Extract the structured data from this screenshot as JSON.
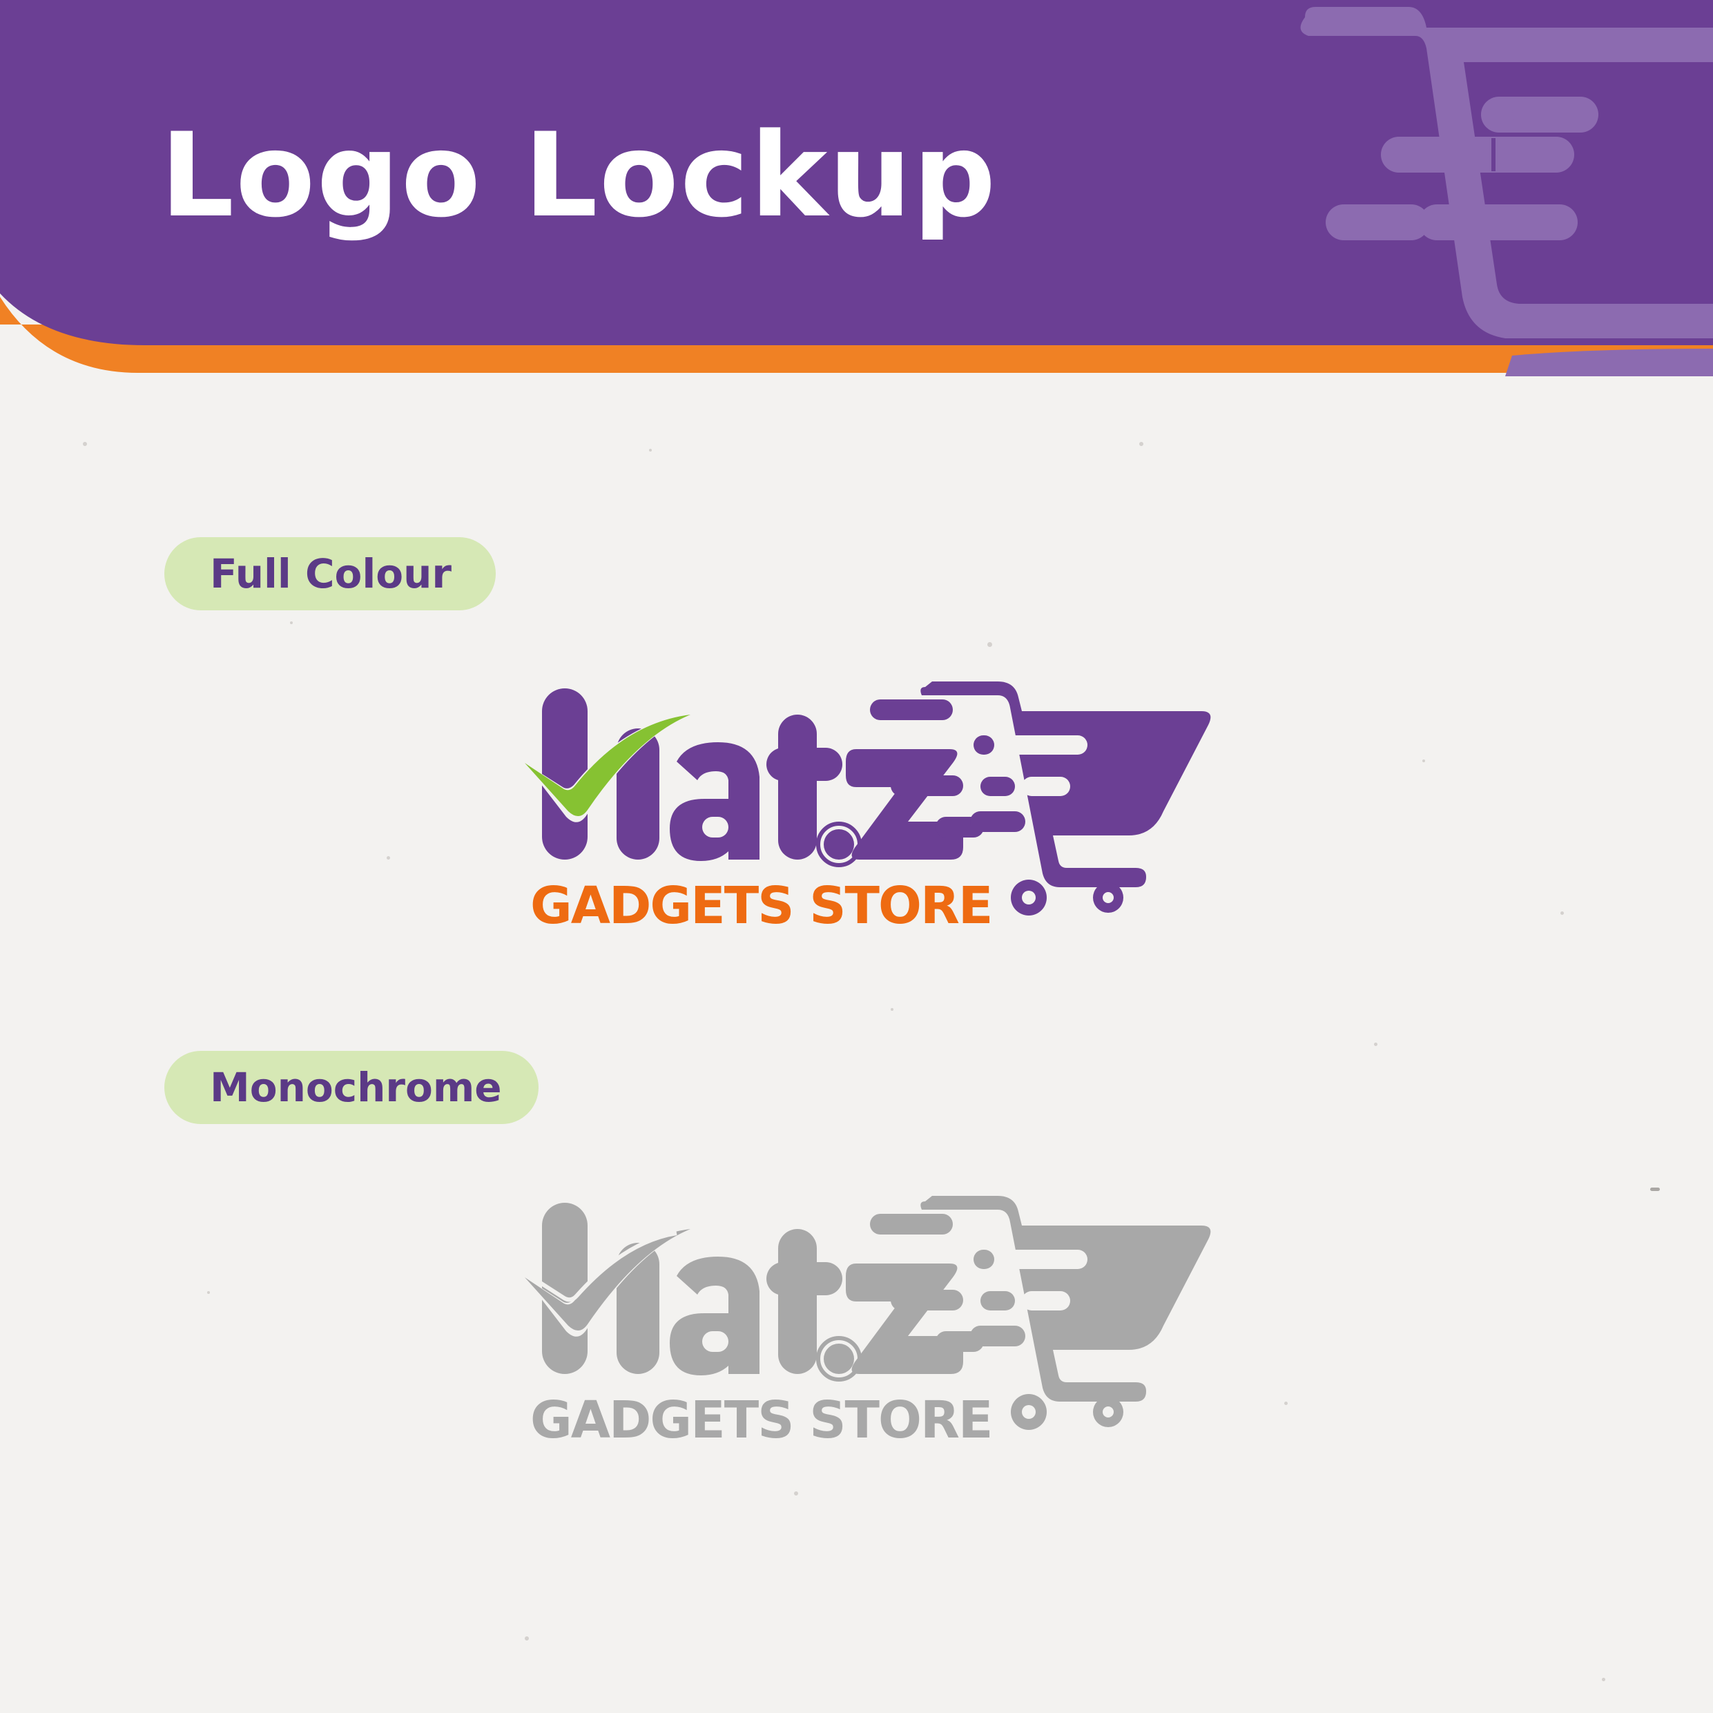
{
  "header": {
    "title": "Logo Lockup"
  },
  "sections": [
    {
      "id": "full",
      "label": "Full Colour",
      "logo": {
        "wordmark": "Hat.z",
        "tagline": "GADGETS STORE"
      }
    },
    {
      "id": "mono",
      "label": "Monochrome",
      "logo": {
        "wordmark": "Hat.z",
        "tagline": "GADGETS STORE"
      }
    }
  ],
  "colors": {
    "brand_purple": "#6b3f94",
    "header_purple_light": "#8c6bb0",
    "brand_orange": "#f07e1f",
    "tagline_orange": "#ee6b12",
    "check_green": "#86c232",
    "pill_green": "#d6e8b5",
    "mono_gray": "#a8a8a8",
    "background": "#f3f2f0"
  }
}
